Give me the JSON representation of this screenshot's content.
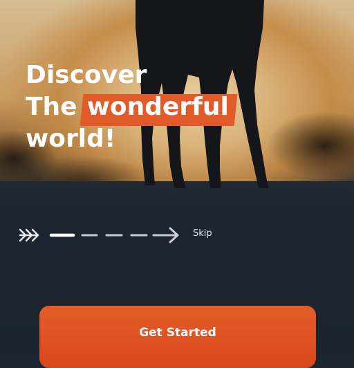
{
  "headline": {
    "line1": "Discover",
    "line2_prefix": "The",
    "line2_highlight": "wonderful",
    "line3": "world!"
  },
  "onboarding": {
    "skip_label": "Skip",
    "current_step": 1,
    "total_steps": 5
  },
  "cta": {
    "label": "Get Started"
  },
  "colors": {
    "accent": "#e05a2a",
    "text": "#ffffff",
    "background": "#1c2530"
  },
  "icons": [
    "double-chevron-right-icon",
    "arrow-right-icon"
  ]
}
